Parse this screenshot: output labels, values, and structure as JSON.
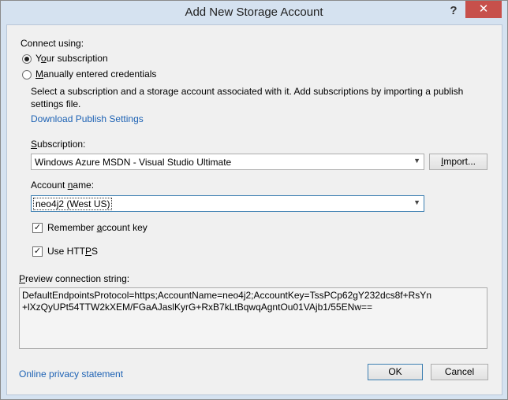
{
  "window": {
    "title": "Add New Storage Account",
    "help_label": "?",
    "close_label": "✕"
  },
  "connect": {
    "heading": "Connect using:",
    "options": [
      {
        "label_pre": "Y",
        "label_ul": "o",
        "label_post": "ur subscription",
        "selected": true
      },
      {
        "label_pre": "",
        "label_ul": "M",
        "label_post": "anually entered credentials",
        "selected": false
      }
    ]
  },
  "description": {
    "text": "Select a subscription and a storage account associated with it. Add subscriptions by importing a publish settings file.",
    "download_link": "Download Publish Settings"
  },
  "subscription": {
    "label_ul": "S",
    "label_rest": "ubscription:",
    "value": "Windows Azure MSDN - Visual Studio Ultimate",
    "import_ul": "I",
    "import_rest": "mport..."
  },
  "account": {
    "label_pre": "Account ",
    "label_ul": "n",
    "label_post": "ame:",
    "value": "neo4j2 (West US)"
  },
  "options": {
    "remember_pre": "Remember ",
    "remember_ul": "a",
    "remember_post": "ccount key",
    "remember_checked": true,
    "https_pre": "Use HTT",
    "https_ul": "P",
    "https_post": "S",
    "https_checked": true
  },
  "preview": {
    "label_ul": "P",
    "label_rest": "review connection string:",
    "line1": "DefaultEndpointsProtocol=https;AccountName=neo4j2;AccountKey=TssPCp62gY232dcs8f+RsYn",
    "line2": "+lXzQyUPt54TTW2kXEM/FGaAJaslKyrG+RxB7kLtBqwqAgntOu01VAjb1/55ENw=="
  },
  "footer": {
    "privacy_link": "Online privacy statement",
    "ok_label": "OK",
    "cancel_label": "Cancel"
  },
  "colors": {
    "link": "#1d62b4",
    "titlebar": "#d5e2f0",
    "close_button": "#c7504b"
  }
}
